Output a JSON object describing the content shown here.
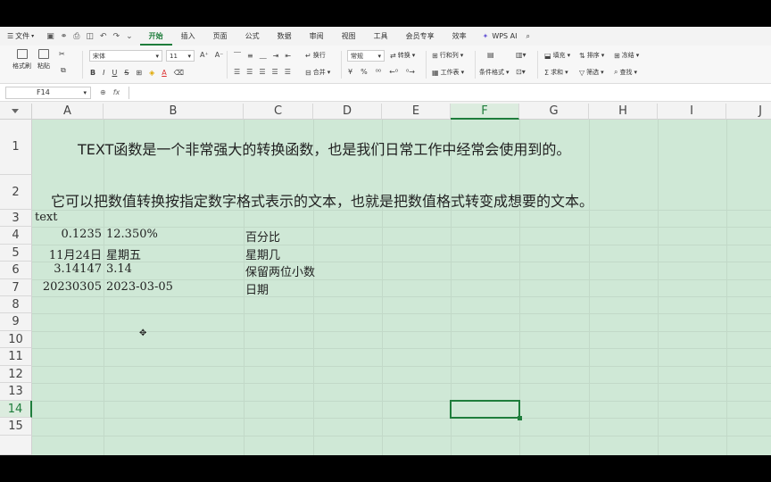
{
  "menu": {
    "file_label": "文件",
    "tabs": [
      "开始",
      "插入",
      "页面",
      "公式",
      "数据",
      "审阅",
      "视图",
      "工具",
      "会员专享",
      "效率"
    ],
    "active_tab": "开始",
    "wps_ai": "WPS AI"
  },
  "ribbon": {
    "format_painter": "格式刷",
    "paste": "粘贴",
    "font_name": "宋体",
    "font_size": "11",
    "wrap": "换行",
    "merge": "合并",
    "number_format": "常规",
    "convert": "转换",
    "row_col": "行和列",
    "worksheet": "工作表",
    "cond_format": "条件格式",
    "fill": "填充",
    "sort": "排序",
    "freeze": "冻结",
    "sum": "求和",
    "filter": "筛选",
    "find": "查找"
  },
  "formula_bar": {
    "cell_ref": "F14",
    "formula": ""
  },
  "sheet": {
    "columns": [
      "A",
      "B",
      "C",
      "D",
      "E",
      "F",
      "G",
      "H",
      "I",
      "J"
    ],
    "rows": [
      "1",
      "2",
      "3",
      "4",
      "5",
      "6",
      "7",
      "8",
      "9",
      "10",
      "11",
      "12",
      "13",
      "14",
      "15"
    ],
    "active_column": "F",
    "active_row": "14",
    "line1": "TEXT函数是一个非常强大的转换函数，也是我们日常工作中经常会使用到的。",
    "line2": "它可以把数值转换按指定数字格式表示的文本，也就是把数值格式转变成想要的文本。",
    "a3": "text",
    "a4": "0.1235",
    "b4": "12.350%",
    "c4": "百分比",
    "a5": "11月24日",
    "b5": "星期五",
    "c5": "星期几",
    "a6": "3.14147",
    "b6": "3.14",
    "c6": "保留两位小数",
    "a7": "20230305",
    "b7": "2023-03-05",
    "c7": "日期"
  },
  "colors": {
    "accent": "#1f7d3c",
    "cell_bg": "#cfe8d6"
  }
}
